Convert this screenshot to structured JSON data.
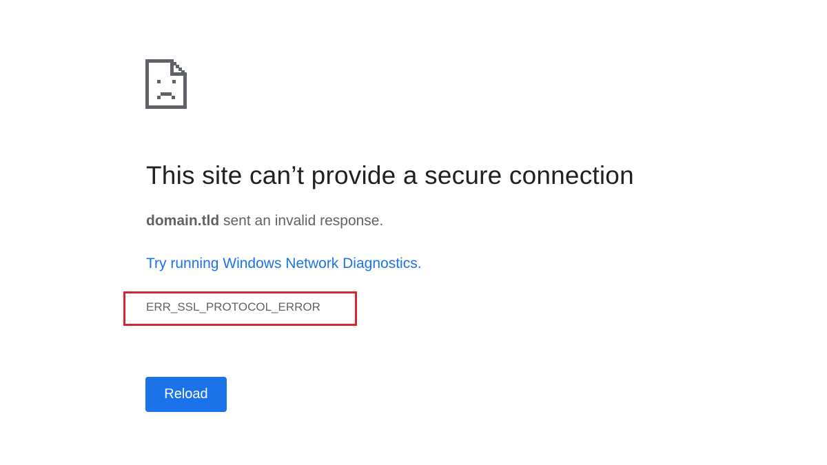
{
  "error_page": {
    "icon": "sad-document-icon",
    "title": "This site can’t provide a secure connection",
    "description": {
      "domain": "domain.tld",
      "message": " sent an invalid response."
    },
    "diagnostics_link": "Try running Windows Network Diagnostics.",
    "error_code": "ERR_SSL_PROTOCOL_ERROR",
    "reload_label": "Reload"
  },
  "colors": {
    "title": "#202124",
    "body_text": "#5f6368",
    "link": "#1a73e8",
    "button": "#1a73e8",
    "highlight_box": "#d62631"
  }
}
